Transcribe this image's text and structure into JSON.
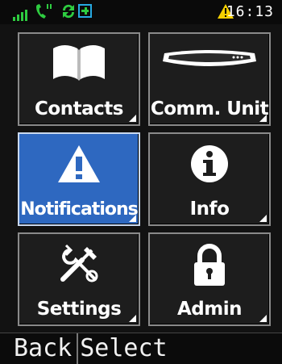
{
  "status_bar": {
    "time": "16:13",
    "icons": [
      "signal-icon",
      "phone-icon",
      "sync-icon",
      "plus-icon",
      "warning-icon"
    ]
  },
  "menu": {
    "tiles": [
      {
        "label": "Contacts",
        "icon": "book-icon",
        "selected": false
      },
      {
        "label": "Comm. Unit",
        "icon": "comm-unit-icon",
        "selected": false
      },
      {
        "label": "Notifications",
        "icon": "warning-icon",
        "selected": true
      },
      {
        "label": "Info",
        "icon": "info-icon",
        "selected": false
      },
      {
        "label": "Settings",
        "icon": "tools-icon",
        "selected": false
      },
      {
        "label": "Admin",
        "icon": "lock-icon",
        "selected": false
      }
    ]
  },
  "softkeys": {
    "left": "Back",
    "right": "Select"
  },
  "colors": {
    "selected_tile": "#2e68c0",
    "warning": "#f5d000",
    "signal": "#2ecc40"
  }
}
